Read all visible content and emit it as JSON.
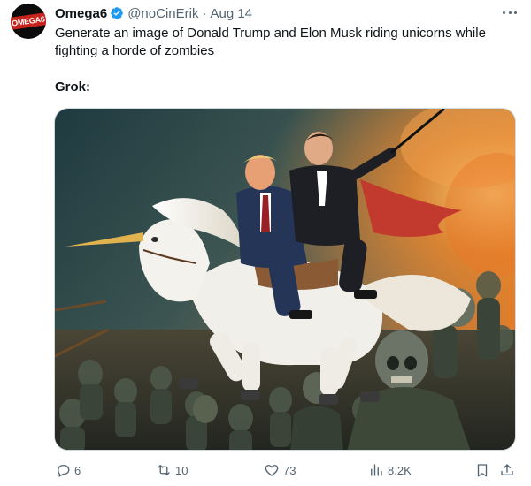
{
  "tweet": {
    "author_name": "Omega6",
    "handle": "@noCinErik",
    "separator": "·",
    "date": "Aug 14",
    "avatar_text": "OMEGA6",
    "text": "Generate an image of Donald Trump and Elon Musk riding unicorns while fighting a horde of zombies",
    "reply_label": "Grok:",
    "media_alt": "Donald Trump and Elon Musk riding a white unicorn while fighting a horde of zombies"
  },
  "actions": {
    "replies": "6",
    "reposts": "10",
    "likes": "73",
    "views": "8.2K"
  },
  "colors": {
    "verified": "#1d9bf0",
    "text_secondary": "#536471",
    "text_primary": "#0f1419"
  },
  "icons": [
    "verified-badge-icon",
    "more-icon",
    "reply-icon",
    "repost-icon",
    "like-icon",
    "views-icon",
    "bookmark-icon",
    "share-icon"
  ]
}
